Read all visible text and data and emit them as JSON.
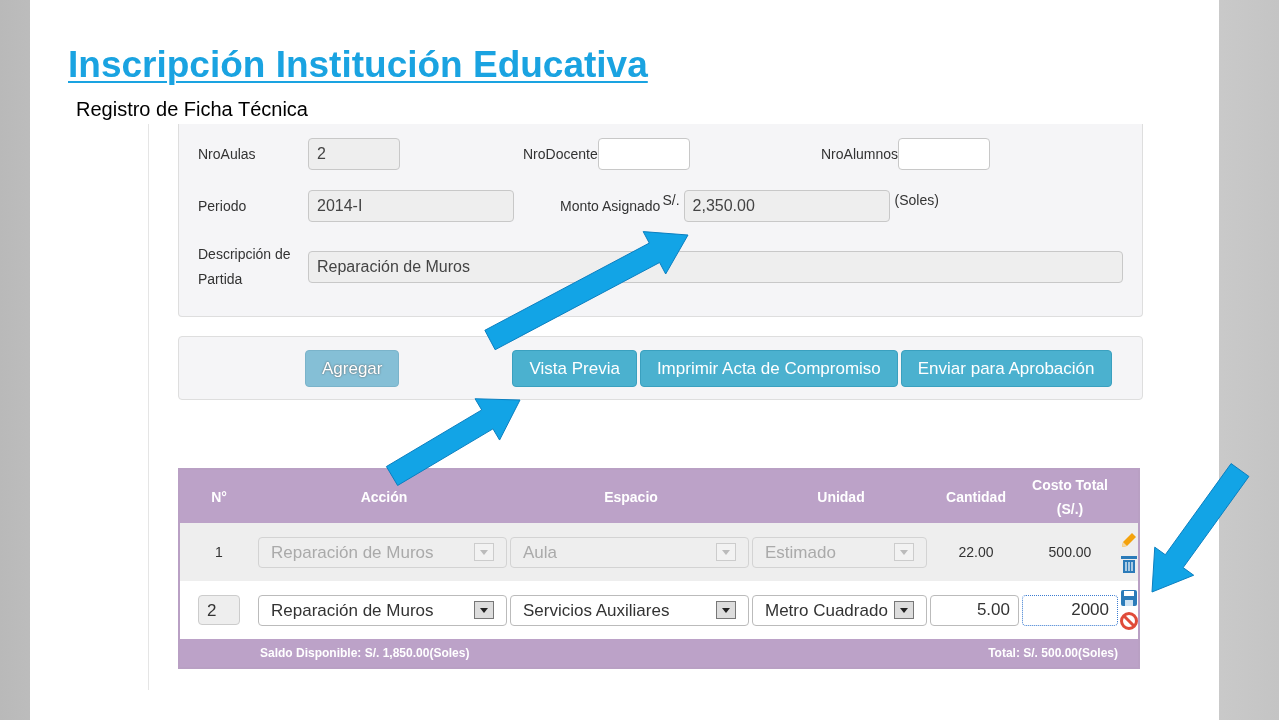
{
  "title": "Inscripción Institución Educativa",
  "subtitle": "Registro de Ficha Técnica",
  "form": {
    "rows": [
      [
        {
          "label": "NroAulas",
          "value": "2",
          "readonly": true
        },
        {
          "label": "NroDocente",
          "readonly": false
        },
        {
          "label": "NroAlumnos",
          "readonly": false
        }
      ],
      [
        {
          "label": "Periodo",
          "value": "2014-I",
          "readonly": true
        },
        {
          "label": "Monto Asignado",
          "prefix": "S/.",
          "value": "2,350.00",
          "suffix": "(Soles)",
          "readonly": true
        }
      ],
      [
        {
          "label": "Descripción de Partida",
          "value": "Reparación de Muros",
          "readonly": true
        }
      ]
    ]
  },
  "actions": [
    {
      "label": "Agregar",
      "disabled": true
    },
    {
      "label": "Vista Previa",
      "disabled": false
    },
    {
      "label": "Imprimir Acta de Compromiso",
      "disabled": false
    },
    {
      "label": "Enviar para Aprobación",
      "disabled": false
    }
  ],
  "table": {
    "columns": [
      "N°",
      "Acción",
      "Espacio",
      "Unidad",
      "Cantidad",
      "Costo Total (S/.)"
    ],
    "rows": [
      {
        "kind": "saved",
        "number": "1",
        "action": "Reparación de Muros",
        "space": "Aula",
        "unit": "Estimado",
        "quantity": "22.00",
        "cost": "500.00"
      },
      {
        "kind": "editing",
        "number": "2",
        "action": "Reparación de Muros",
        "space": "Servicios Auxiliares",
        "unit": "Metro Cuadrado",
        "quantity": "5.00",
        "cost": "2000"
      }
    ],
    "footer": {
      "balance": "Saldo Disponible: S/. 1,850.00(Soles)",
      "total": "Total: S/. 500.00(Soles)"
    }
  }
}
